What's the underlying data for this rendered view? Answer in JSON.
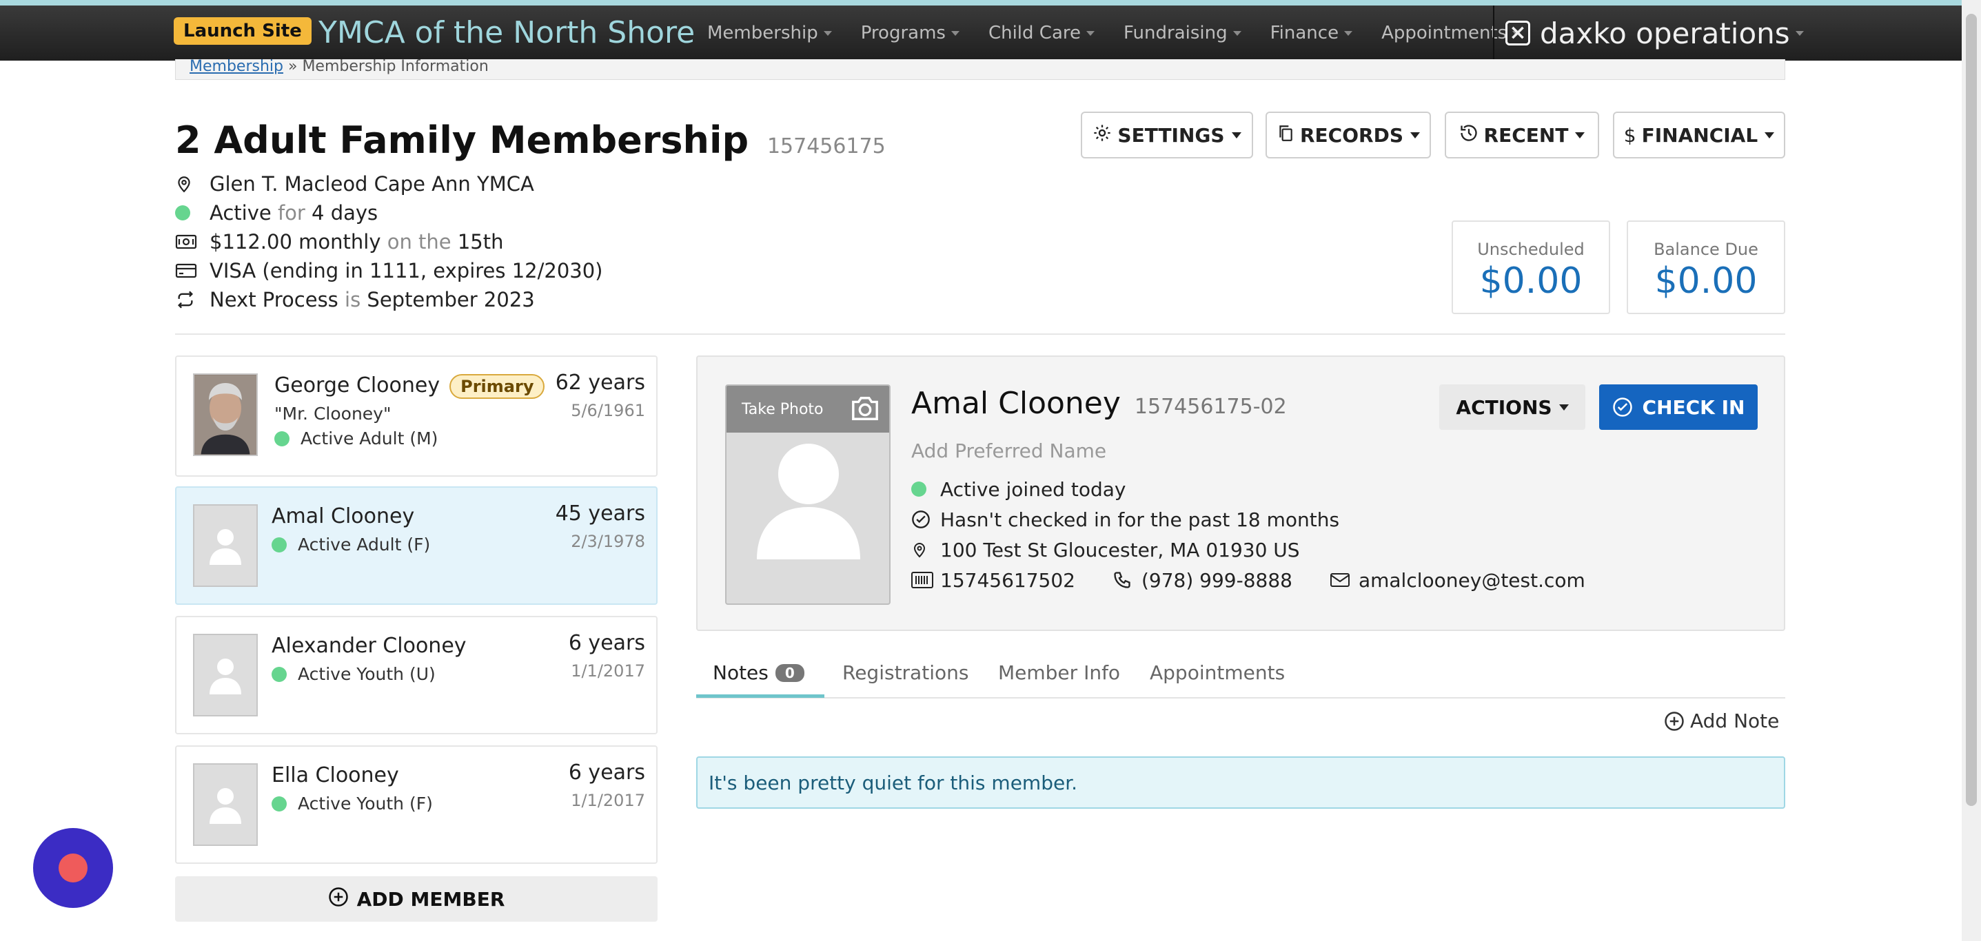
{
  "navbar": {
    "launch_label": "Launch Site",
    "brand": "YMCA of the North Shore",
    "items": [
      {
        "label": "Membership"
      },
      {
        "label": "Programs"
      },
      {
        "label": "Child Care"
      },
      {
        "label": "Fundraising"
      },
      {
        "label": "Finance"
      },
      {
        "label": "Appointments"
      }
    ],
    "product": "daxko operations"
  },
  "breadcrumb": {
    "parent": "Membership",
    "separator": "»",
    "current": "Membership Information"
  },
  "header": {
    "title": "2 Adult Family Membership",
    "id": "157456175",
    "buttons": {
      "settings": "SETTINGS",
      "records": "RECORDS",
      "recent": "RECENT",
      "financial": "FINANCIAL"
    }
  },
  "membership": {
    "branch": "Glen T. Macleod Cape Ann YMCA",
    "status": "Active",
    "status_for": "for",
    "status_duration": "4 days",
    "amount": "$112.00 monthly",
    "amount_on": "on the",
    "amount_day": "15th",
    "payment": "VISA (ending in 1111, expires 12/2030)",
    "next_process": "Next Process",
    "next_is": "is",
    "next_date": "September 2023"
  },
  "balances": {
    "unscheduled_label": "Unscheduled",
    "unscheduled_value": "$0.00",
    "balance_label": "Balance Due",
    "balance_value": "$0.00"
  },
  "members": [
    {
      "name": "George Clooney",
      "badge": "Primary",
      "nickname": "\"Mr. Clooney\"",
      "status": "Active Adult (M)",
      "age": "62 years",
      "dob": "5/6/1961"
    },
    {
      "name": "Amal Clooney",
      "status": "Active Adult (F)",
      "age": "45 years",
      "dob": "2/3/1978"
    },
    {
      "name": "Alexander Clooney",
      "status": "Active Youth (U)",
      "age": "6 years",
      "dob": "1/1/2017"
    },
    {
      "name": "Ella Clooney",
      "status": "Active Youth (F)",
      "age": "6 years",
      "dob": "1/1/2017"
    }
  ],
  "add_member_label": "ADD MEMBER",
  "detail": {
    "take_photo": "Take Photo",
    "name": "Amal Clooney",
    "id": "157456175-02",
    "preferred_placeholder": "Add Preferred Name",
    "status": "Active joined today",
    "checkin_info": "Hasn't checked in for the past 18 months",
    "address": "100 Test St Gloucester, MA 01930 US",
    "card": "15745617502",
    "phone": "(978) 999-8888",
    "email": "amalclooney@test.com",
    "actions_label": "ACTIONS",
    "checkin_label": "CHECK IN"
  },
  "tabs": [
    {
      "label": "Notes",
      "count": "0"
    },
    {
      "label": "Registrations"
    },
    {
      "label": "Member Info"
    },
    {
      "label": "Appointments"
    }
  ],
  "add_note_label": "Add Note",
  "empty_message": "It's been pretty quiet for this member.",
  "colors": {
    "accent": "#1565c0",
    "status_active": "#66d58f",
    "launch": "#f4b83a",
    "chat": "#3b2cc4"
  }
}
